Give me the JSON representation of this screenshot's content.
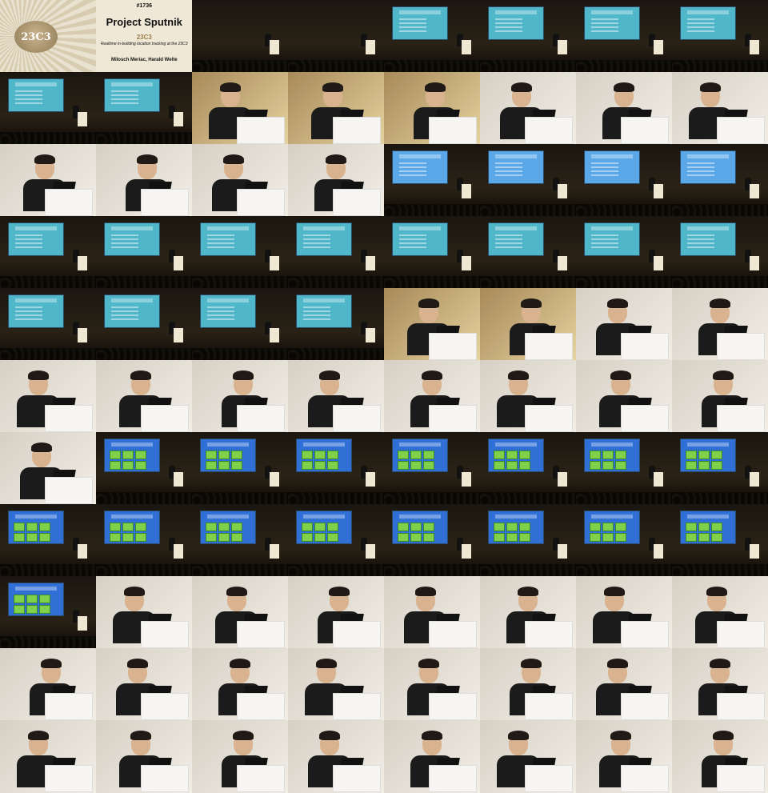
{
  "layout": {
    "cols": 8,
    "rows": 11
  },
  "title_card": {
    "event_number": "#1736",
    "event_logo": "23C3",
    "title": "Project Sputnik",
    "subtitle": "Realtime in-building location tracking at the 23C3",
    "authors": "Milosch Meriac, Harald Welte"
  },
  "tiles": [
    "title-art",
    "title-text",
    "stage-blank",
    "stage-blank",
    "stage-slide",
    "stage-slide",
    "stage-slide",
    "stage-slide",
    "stage-slide",
    "stage-slide",
    "closeup-warm",
    "closeup-warm",
    "closeup-warm",
    "closeup",
    "closeup",
    "closeup",
    "closeup",
    "closeup",
    "closeup",
    "closeup",
    "stage-slide-blue",
    "stage-slide-blue",
    "stage-slide-blue",
    "stage-slide-blue",
    "stage-slide",
    "stage-slide",
    "stage-slide",
    "stage-slide",
    "stage-slide",
    "stage-slide",
    "stage-slide",
    "stage-slide",
    "stage-slide",
    "stage-slide",
    "stage-slide",
    "stage-slide",
    "closeup-warm",
    "closeup-warm",
    "closeup",
    "closeup",
    "closeup",
    "closeup",
    "closeup",
    "closeup",
    "closeup",
    "closeup",
    "closeup",
    "closeup",
    "closeup",
    "stage-arch",
    "stage-arch",
    "stage-arch",
    "stage-arch",
    "stage-arch",
    "stage-arch",
    "stage-arch",
    "stage-arch",
    "stage-arch",
    "stage-arch",
    "stage-arch",
    "stage-arch",
    "stage-arch",
    "stage-arch",
    "stage-arch",
    "stage-arch",
    "closeup",
    "closeup",
    "closeup",
    "closeup",
    "closeup",
    "closeup",
    "closeup",
    "closeup",
    "closeup",
    "closeup",
    "closeup",
    "closeup",
    "closeup",
    "closeup",
    "closeup",
    "closeup",
    "closeup",
    "closeup",
    "closeup",
    "closeup",
    "closeup",
    "closeup",
    "closeup"
  ],
  "colors": {
    "slide_teal": "#4fb7c9",
    "slide_blue": "#2f6fd6",
    "slide_green": "#7fd04a",
    "stage_dark": "#1a160f"
  }
}
